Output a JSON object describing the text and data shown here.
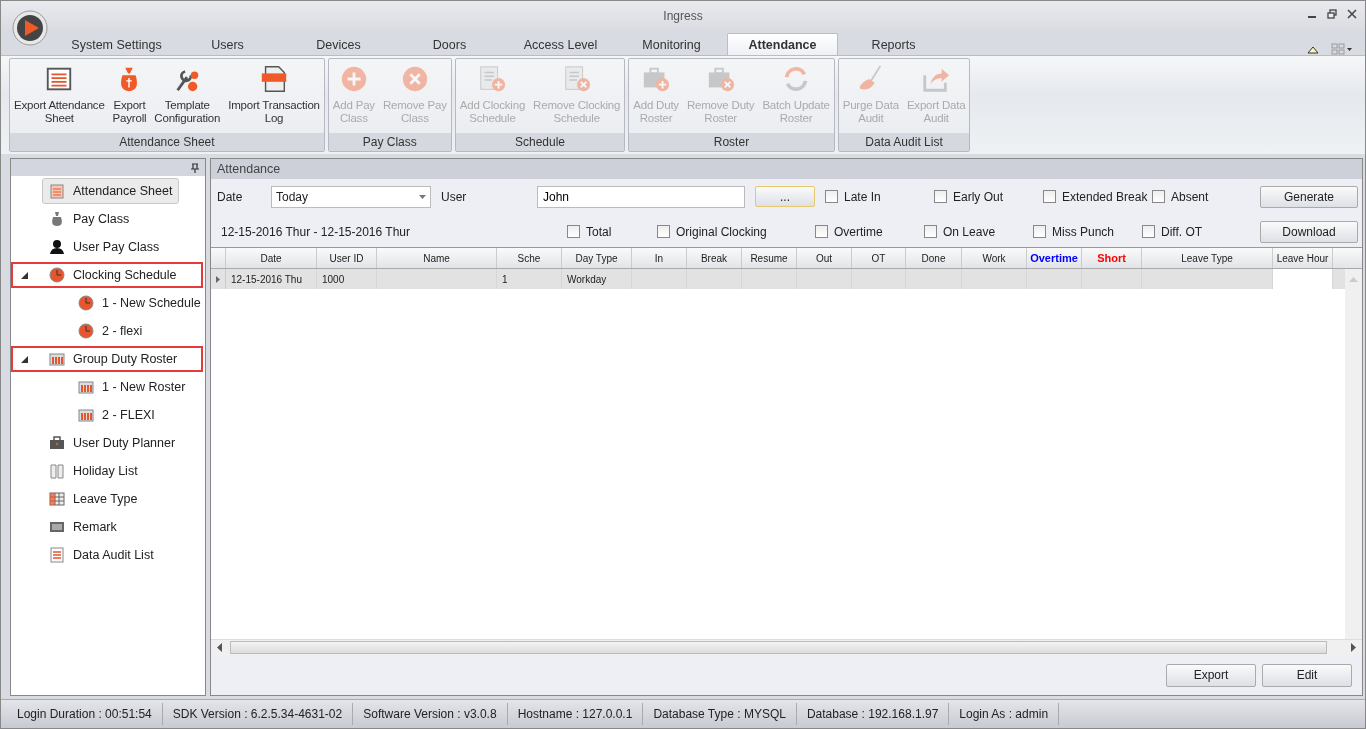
{
  "window": {
    "title": "Ingress"
  },
  "tabs": [
    {
      "label": "System Settings",
      "selected": false
    },
    {
      "label": "Users",
      "selected": false
    },
    {
      "label": "Devices",
      "selected": false
    },
    {
      "label": "Doors",
      "selected": false
    },
    {
      "label": "Access Level",
      "selected": false
    },
    {
      "label": "Monitoring",
      "selected": false
    },
    {
      "label": "Attendance",
      "selected": true
    },
    {
      "label": "Reports",
      "selected": false
    }
  ],
  "ribbon": [
    {
      "title": "Attendance Sheet",
      "buttons": [
        {
          "label": "Export Attendance\nSheet",
          "disabled": false
        },
        {
          "label": "Export\nPayroll",
          "disabled": false
        },
        {
          "label": "Template\nConfiguration",
          "disabled": false
        },
        {
          "label": "Import Transaction\nLog",
          "disabled": false
        }
      ]
    },
    {
      "title": "Pay Class",
      "buttons": [
        {
          "label": "Add Pay\nClass",
          "disabled": true
        },
        {
          "label": "Remove Pay\nClass",
          "disabled": true
        }
      ]
    },
    {
      "title": "Schedule",
      "buttons": [
        {
          "label": "Add Clocking\nSchedule",
          "disabled": true
        },
        {
          "label": "Remove Clocking\nSchedule",
          "disabled": true
        }
      ]
    },
    {
      "title": "Roster",
      "buttons": [
        {
          "label": "Add Duty\nRoster",
          "disabled": true
        },
        {
          "label": "Remove Duty\nRoster",
          "disabled": true
        },
        {
          "label": "Batch Update\nRoster",
          "disabled": true
        }
      ]
    },
    {
      "title": "Data Audit List",
      "buttons": [
        {
          "label": "Purge Data\nAudit",
          "disabled": true
        },
        {
          "label": "Export Data\nAudit",
          "disabled": true
        }
      ]
    }
  ],
  "sidebar": {
    "items": [
      {
        "label": "Attendance Sheet",
        "selected": true,
        "highlighted": false
      },
      {
        "label": "Pay Class",
        "selected": false,
        "highlighted": false
      },
      {
        "label": "User Pay Class",
        "selected": false,
        "highlighted": false
      },
      {
        "label": "Clocking Schedule",
        "selected": false,
        "highlighted": true,
        "expanded": true,
        "children": [
          {
            "label": "1 - New Schedule",
            "selected": false
          },
          {
            "label": "2 - flexi",
            "selected": false
          }
        ]
      },
      {
        "label": "Group Duty Roster",
        "selected": false,
        "highlighted": true,
        "expanded": true,
        "children": [
          {
            "label": "1 - New Roster",
            "selected": false
          },
          {
            "label": "2 - FLEXI",
            "selected": false
          }
        ]
      },
      {
        "label": "User Duty Planner",
        "selected": false,
        "highlighted": false
      },
      {
        "label": "Holiday List",
        "selected": false,
        "highlighted": false
      },
      {
        "label": "Leave Type",
        "selected": false,
        "highlighted": false
      },
      {
        "label": "Remark",
        "selected": false,
        "highlighted": false
      },
      {
        "label": "Data Audit List",
        "selected": false,
        "highlighted": false
      }
    ]
  },
  "panel": {
    "title": "Attendance",
    "date_label": "Date",
    "date_value": "Today",
    "user_label": "User",
    "user_value": "John",
    "browse_button": "...",
    "range": "12-15-2016 Thur - 12-15-2016 Thur",
    "filters": [
      {
        "label": "Late In",
        "checked": false
      },
      {
        "label": "Early Out",
        "checked": false
      },
      {
        "label": "Extended Break",
        "checked": false
      },
      {
        "label": "Absent",
        "checked": false
      },
      {
        "label": "Total",
        "checked": false
      },
      {
        "label": "Original Clocking",
        "checked": false
      },
      {
        "label": "Overtime",
        "checked": false
      },
      {
        "label": "On Leave",
        "checked": false
      },
      {
        "label": "Miss Punch",
        "checked": false
      },
      {
        "label": "Diff. OT",
        "checked": false
      }
    ],
    "generate_button": "Generate",
    "download_button": "Download",
    "table": {
      "columns": [
        {
          "label": "Date"
        },
        {
          "label": "User ID"
        },
        {
          "label": "Name"
        },
        {
          "label": "Sche"
        },
        {
          "label": "Day Type"
        },
        {
          "label": "In"
        },
        {
          "label": "Break"
        },
        {
          "label": "Resume"
        },
        {
          "label": "Out"
        },
        {
          "label": "OT"
        },
        {
          "label": "Done"
        },
        {
          "label": "Work"
        },
        {
          "label": "Overtime",
          "color": "#0000ff"
        },
        {
          "label": "Short",
          "color": "#ff0000"
        },
        {
          "label": "Leave Type"
        },
        {
          "label": "Leave Hour"
        }
      ],
      "rows": [
        {
          "cells": [
            "12-15-2016  Thu",
            "1000",
            "",
            "1",
            "Workday",
            "",
            "",
            "",
            "",
            "",
            "",
            "",
            "",
            "",
            "",
            ""
          ]
        }
      ]
    },
    "export_button": "Export",
    "edit_button": "Edit"
  },
  "status_bar": [
    "Login Duration : 00:51:54",
    "SDK Version : 6.2.5.34-4631-02",
    "Software Version : v3.0.8",
    "Hostname : 127.0.0.1",
    "Database Type : MYSQL",
    "Database : 192.168.1.97",
    "Login As : admin"
  ]
}
